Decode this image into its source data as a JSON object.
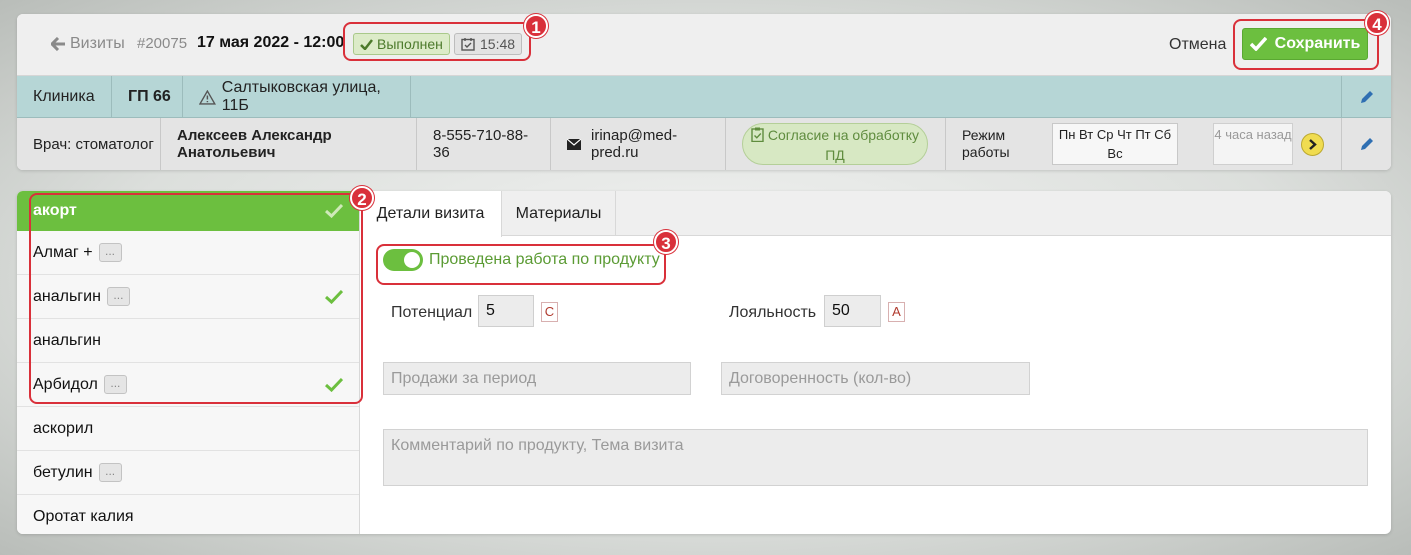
{
  "header": {
    "back_label": "Визиты",
    "visit_id": "#20075",
    "visit_date": "17 мая 2022 - 12:00",
    "status": "Выполнен",
    "time": "15:48",
    "cancel_label": "Отмена",
    "save_label": "Сохранить"
  },
  "clinic": {
    "label": "Клиника",
    "code": "ГП 66",
    "address": "Салтыковская улица, 11Б"
  },
  "doctor": {
    "role": "Врач: стоматолог",
    "name": "Алексеев Александр Анатольевич",
    "phone": "8-555-710-88-36",
    "email": "irinap@med-pred.ru",
    "consent": "Согласие на обработку ПД",
    "schedule_label": "Режим работы",
    "schedule_days": "Пн Вт Ср Чт Пт Сб Вс",
    "last_seen": "4 часа назад"
  },
  "products": [
    {
      "name": "акорт",
      "dots": "",
      "checked": true
    },
    {
      "name": "Алмаг +",
      "dots": "...",
      "checked": false
    },
    {
      "name": "анальгин",
      "dots": "...",
      "checked": true
    },
    {
      "name": "анальгин",
      "dots": "",
      "checked": false
    },
    {
      "name": "Арбидол",
      "dots": "...",
      "checked": true
    },
    {
      "name": "аскорил",
      "dots": "",
      "checked": false
    },
    {
      "name": "бетулин",
      "dots": "...",
      "checked": false
    },
    {
      "name": "Оротат калия",
      "dots": "",
      "checked": false
    }
  ],
  "tabs": [
    "Детали визита",
    "Материалы"
  ],
  "form": {
    "toggle_label": "Проведена работа по продукту",
    "potential_label": "Потенциал",
    "potential_value": "5",
    "potential_grade": "C",
    "loyalty_label": "Лояльность",
    "loyalty_value": "50",
    "loyalty_grade": "A",
    "sales_placeholder": "Продажи за период",
    "agreement_placeholder": "Договоренность (кол-во)",
    "comment_placeholder": "Комментарий по продукту, Тема визита"
  },
  "callouts": [
    "1",
    "2",
    "3",
    "4"
  ],
  "colors": {
    "accent_green": "#6cbf3f",
    "callout_red": "#d9303a",
    "clinic_row": "#b6d6d6"
  }
}
